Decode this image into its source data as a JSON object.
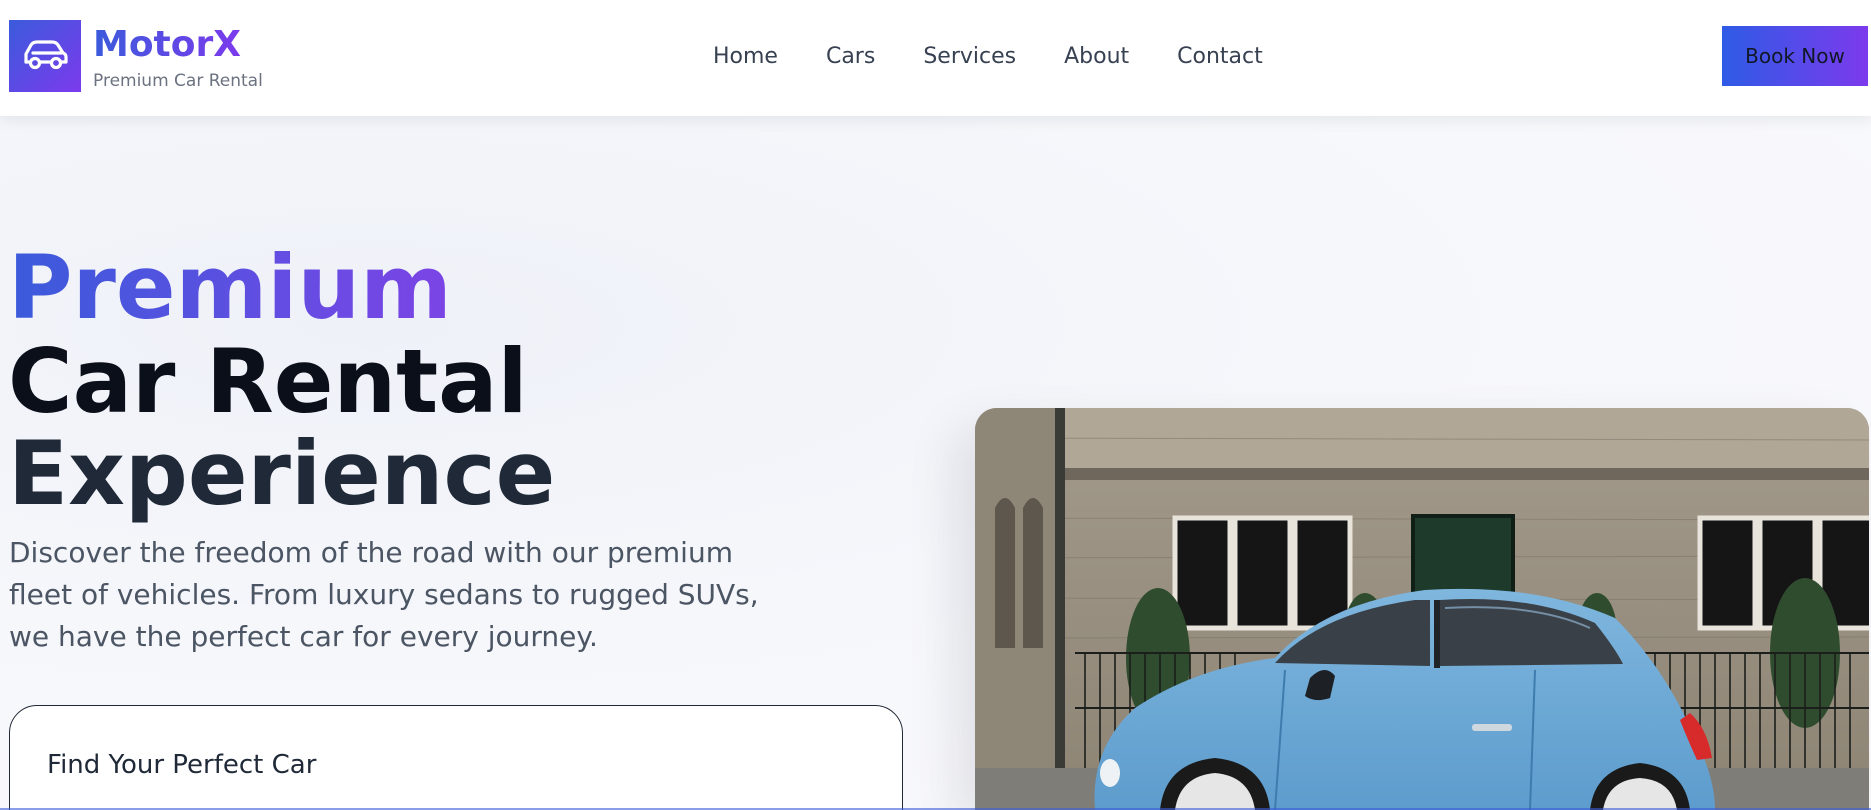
{
  "brand": {
    "name": "MotorX",
    "tagline": "Premium Car Rental",
    "logo_icon": "car-icon"
  },
  "nav": {
    "items": [
      {
        "label": "Home"
      },
      {
        "label": "Cars"
      },
      {
        "label": "Services"
      },
      {
        "label": "About"
      },
      {
        "label": "Contact"
      }
    ],
    "cta_label": "Book Now"
  },
  "hero": {
    "headline_line1": "Premium",
    "headline_line2": "Car Rental",
    "headline_line3": "Experience",
    "description": "Discover the freedom of the road with our premium fleet of vehicles. From luxury sedans to rugged SUVs, we have the perfect car for every journey.",
    "search_title": "Find Your Perfect Car",
    "image_subject": "light-blue-compact-car-photo"
  },
  "colors": {
    "accent_start": "#3b5bdb",
    "accent_end": "#7c3aed",
    "heading": "#0b0f1a",
    "body_text": "#4b5563"
  }
}
